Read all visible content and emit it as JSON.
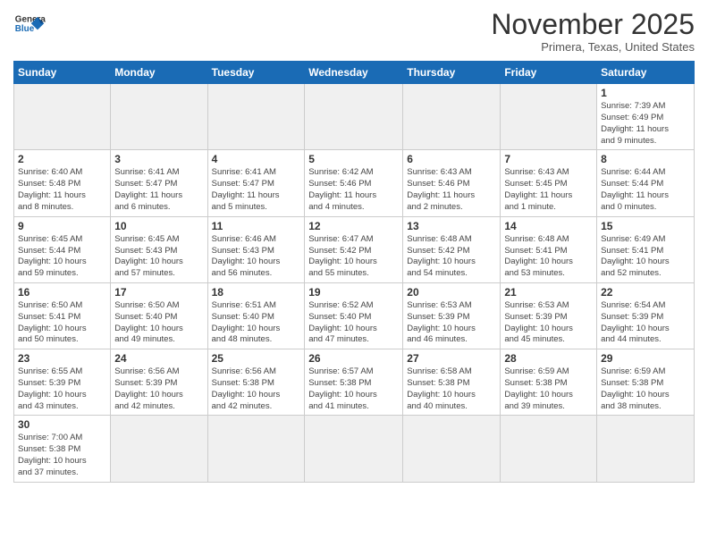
{
  "header": {
    "logo_general": "General",
    "logo_blue": "Blue",
    "month_title": "November 2025",
    "location": "Primera, Texas, United States"
  },
  "weekdays": [
    "Sunday",
    "Monday",
    "Tuesday",
    "Wednesday",
    "Thursday",
    "Friday",
    "Saturday"
  ],
  "weeks": [
    [
      {
        "day": "",
        "info": ""
      },
      {
        "day": "",
        "info": ""
      },
      {
        "day": "",
        "info": ""
      },
      {
        "day": "",
        "info": ""
      },
      {
        "day": "",
        "info": ""
      },
      {
        "day": "",
        "info": ""
      },
      {
        "day": "1",
        "info": "Sunrise: 7:39 AM\nSunset: 6:49 PM\nDaylight: 11 hours\nand 9 minutes."
      }
    ],
    [
      {
        "day": "2",
        "info": "Sunrise: 6:40 AM\nSunset: 5:48 PM\nDaylight: 11 hours\nand 8 minutes."
      },
      {
        "day": "3",
        "info": "Sunrise: 6:41 AM\nSunset: 5:47 PM\nDaylight: 11 hours\nand 6 minutes."
      },
      {
        "day": "4",
        "info": "Sunrise: 6:41 AM\nSunset: 5:47 PM\nDaylight: 11 hours\nand 5 minutes."
      },
      {
        "day": "5",
        "info": "Sunrise: 6:42 AM\nSunset: 5:46 PM\nDaylight: 11 hours\nand 4 minutes."
      },
      {
        "day": "6",
        "info": "Sunrise: 6:43 AM\nSunset: 5:46 PM\nDaylight: 11 hours\nand 2 minutes."
      },
      {
        "day": "7",
        "info": "Sunrise: 6:43 AM\nSunset: 5:45 PM\nDaylight: 11 hours\nand 1 minute."
      },
      {
        "day": "8",
        "info": "Sunrise: 6:44 AM\nSunset: 5:44 PM\nDaylight: 11 hours\nand 0 minutes."
      }
    ],
    [
      {
        "day": "9",
        "info": "Sunrise: 6:45 AM\nSunset: 5:44 PM\nDaylight: 10 hours\nand 59 minutes."
      },
      {
        "day": "10",
        "info": "Sunrise: 6:45 AM\nSunset: 5:43 PM\nDaylight: 10 hours\nand 57 minutes."
      },
      {
        "day": "11",
        "info": "Sunrise: 6:46 AM\nSunset: 5:43 PM\nDaylight: 10 hours\nand 56 minutes."
      },
      {
        "day": "12",
        "info": "Sunrise: 6:47 AM\nSunset: 5:42 PM\nDaylight: 10 hours\nand 55 minutes."
      },
      {
        "day": "13",
        "info": "Sunrise: 6:48 AM\nSunset: 5:42 PM\nDaylight: 10 hours\nand 54 minutes."
      },
      {
        "day": "14",
        "info": "Sunrise: 6:48 AM\nSunset: 5:41 PM\nDaylight: 10 hours\nand 53 minutes."
      },
      {
        "day": "15",
        "info": "Sunrise: 6:49 AM\nSunset: 5:41 PM\nDaylight: 10 hours\nand 52 minutes."
      }
    ],
    [
      {
        "day": "16",
        "info": "Sunrise: 6:50 AM\nSunset: 5:41 PM\nDaylight: 10 hours\nand 50 minutes."
      },
      {
        "day": "17",
        "info": "Sunrise: 6:50 AM\nSunset: 5:40 PM\nDaylight: 10 hours\nand 49 minutes."
      },
      {
        "day": "18",
        "info": "Sunrise: 6:51 AM\nSunset: 5:40 PM\nDaylight: 10 hours\nand 48 minutes."
      },
      {
        "day": "19",
        "info": "Sunrise: 6:52 AM\nSunset: 5:40 PM\nDaylight: 10 hours\nand 47 minutes."
      },
      {
        "day": "20",
        "info": "Sunrise: 6:53 AM\nSunset: 5:39 PM\nDaylight: 10 hours\nand 46 minutes."
      },
      {
        "day": "21",
        "info": "Sunrise: 6:53 AM\nSunset: 5:39 PM\nDaylight: 10 hours\nand 45 minutes."
      },
      {
        "day": "22",
        "info": "Sunrise: 6:54 AM\nSunset: 5:39 PM\nDaylight: 10 hours\nand 44 minutes."
      }
    ],
    [
      {
        "day": "23",
        "info": "Sunrise: 6:55 AM\nSunset: 5:39 PM\nDaylight: 10 hours\nand 43 minutes."
      },
      {
        "day": "24",
        "info": "Sunrise: 6:56 AM\nSunset: 5:39 PM\nDaylight: 10 hours\nand 42 minutes."
      },
      {
        "day": "25",
        "info": "Sunrise: 6:56 AM\nSunset: 5:38 PM\nDaylight: 10 hours\nand 42 minutes."
      },
      {
        "day": "26",
        "info": "Sunrise: 6:57 AM\nSunset: 5:38 PM\nDaylight: 10 hours\nand 41 minutes."
      },
      {
        "day": "27",
        "info": "Sunrise: 6:58 AM\nSunset: 5:38 PM\nDaylight: 10 hours\nand 40 minutes."
      },
      {
        "day": "28",
        "info": "Sunrise: 6:59 AM\nSunset: 5:38 PM\nDaylight: 10 hours\nand 39 minutes."
      },
      {
        "day": "29",
        "info": "Sunrise: 6:59 AM\nSunset: 5:38 PM\nDaylight: 10 hours\nand 38 minutes."
      }
    ],
    [
      {
        "day": "30",
        "info": "Sunrise: 7:00 AM\nSunset: 5:38 PM\nDaylight: 10 hours\nand 37 minutes."
      },
      {
        "day": "",
        "info": ""
      },
      {
        "day": "",
        "info": ""
      },
      {
        "day": "",
        "info": ""
      },
      {
        "day": "",
        "info": ""
      },
      {
        "day": "",
        "info": ""
      },
      {
        "day": "",
        "info": ""
      }
    ]
  ]
}
